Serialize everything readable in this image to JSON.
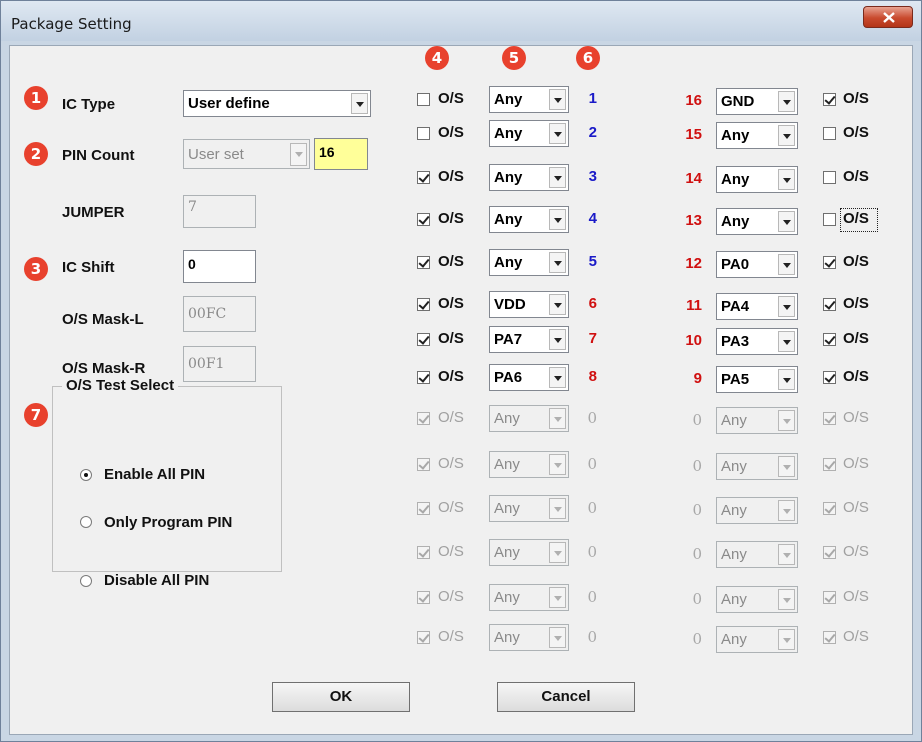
{
  "window": {
    "title": "Package Setting"
  },
  "badges": [
    "1",
    "2",
    "3",
    "4",
    "5",
    "6",
    "7"
  ],
  "left": {
    "ic_type_label": "IC Type",
    "ic_type_value": "User define",
    "pin_count_label": "PIN Count",
    "pin_count_select": "User set",
    "pin_count_value": "16",
    "jumper_label": "JUMPER",
    "jumper_value": "7",
    "ic_shift_label": "IC Shift",
    "ic_shift_value": "0",
    "mask_l_label": "O/S Mask-L",
    "mask_l_value": "00FC",
    "mask_r_label": "O/S Mask-R",
    "mask_r_value": "00F1"
  },
  "os_test": {
    "title": "O/S Test Select",
    "options": [
      "Enable All PIN",
      "Only Program PIN",
      "Disable All PIN"
    ],
    "selected_index": 0
  },
  "os_label": "O/S",
  "rows": [
    {
      "lchk": false,
      "lval": "Any",
      "lpin": "1",
      "lcolor": "blue",
      "rpin": "16",
      "rval": "GND",
      "rchk": true
    },
    {
      "lchk": false,
      "lval": "Any",
      "lpin": "2",
      "lcolor": "blue",
      "rpin": "15",
      "rval": "Any",
      "rchk": false
    },
    {
      "lchk": true,
      "lval": "Any",
      "lpin": "3",
      "lcolor": "blue",
      "rpin": "14",
      "rval": "Any",
      "rchk": false
    },
    {
      "lchk": true,
      "lval": "Any",
      "lpin": "4",
      "lcolor": "blue",
      "rpin": "13",
      "rval": "Any",
      "rchk": false
    },
    {
      "lchk": true,
      "lval": "Any",
      "lpin": "5",
      "lcolor": "blue",
      "rpin": "12",
      "rval": "PA0",
      "rchk": true
    },
    {
      "lchk": true,
      "lval": "VDD",
      "lpin": "6",
      "lcolor": "red",
      "rpin": "11",
      "rval": "PA4",
      "rchk": true
    },
    {
      "lchk": true,
      "lval": "PA7",
      "lpin": "7",
      "lcolor": "red",
      "rpin": "10",
      "rval": "PA3",
      "rchk": true
    },
    {
      "lchk": true,
      "lval": "PA6",
      "lpin": "8",
      "lcolor": "red",
      "rpin": "9",
      "rval": "PA5",
      "rchk": true
    },
    {
      "lchk": true,
      "lval": "Any",
      "lpin": "0",
      "lcolor": "dis",
      "rpin": "0",
      "rval": "Any",
      "rchk": true,
      "disabled": true
    },
    {
      "lchk": true,
      "lval": "Any",
      "lpin": "0",
      "lcolor": "dis",
      "rpin": "0",
      "rval": "Any",
      "rchk": true,
      "disabled": true
    },
    {
      "lchk": true,
      "lval": "Any",
      "lpin": "0",
      "lcolor": "dis",
      "rpin": "0",
      "rval": "Any",
      "rchk": true,
      "disabled": true
    },
    {
      "lchk": true,
      "lval": "Any",
      "lpin": "0",
      "lcolor": "dis",
      "rpin": "0",
      "rval": "Any",
      "rchk": true,
      "disabled": true
    },
    {
      "lchk": true,
      "lval": "Any",
      "lpin": "0",
      "lcolor": "dis",
      "rpin": "0",
      "rval": "Any",
      "rchk": true,
      "disabled": true
    },
    {
      "lchk": true,
      "lval": "Any",
      "lpin": "0",
      "lcolor": "dis",
      "rpin": "0",
      "rval": "Any",
      "rchk": true,
      "disabled": true
    }
  ],
  "buttons": {
    "ok": "OK",
    "cancel": "Cancel"
  }
}
